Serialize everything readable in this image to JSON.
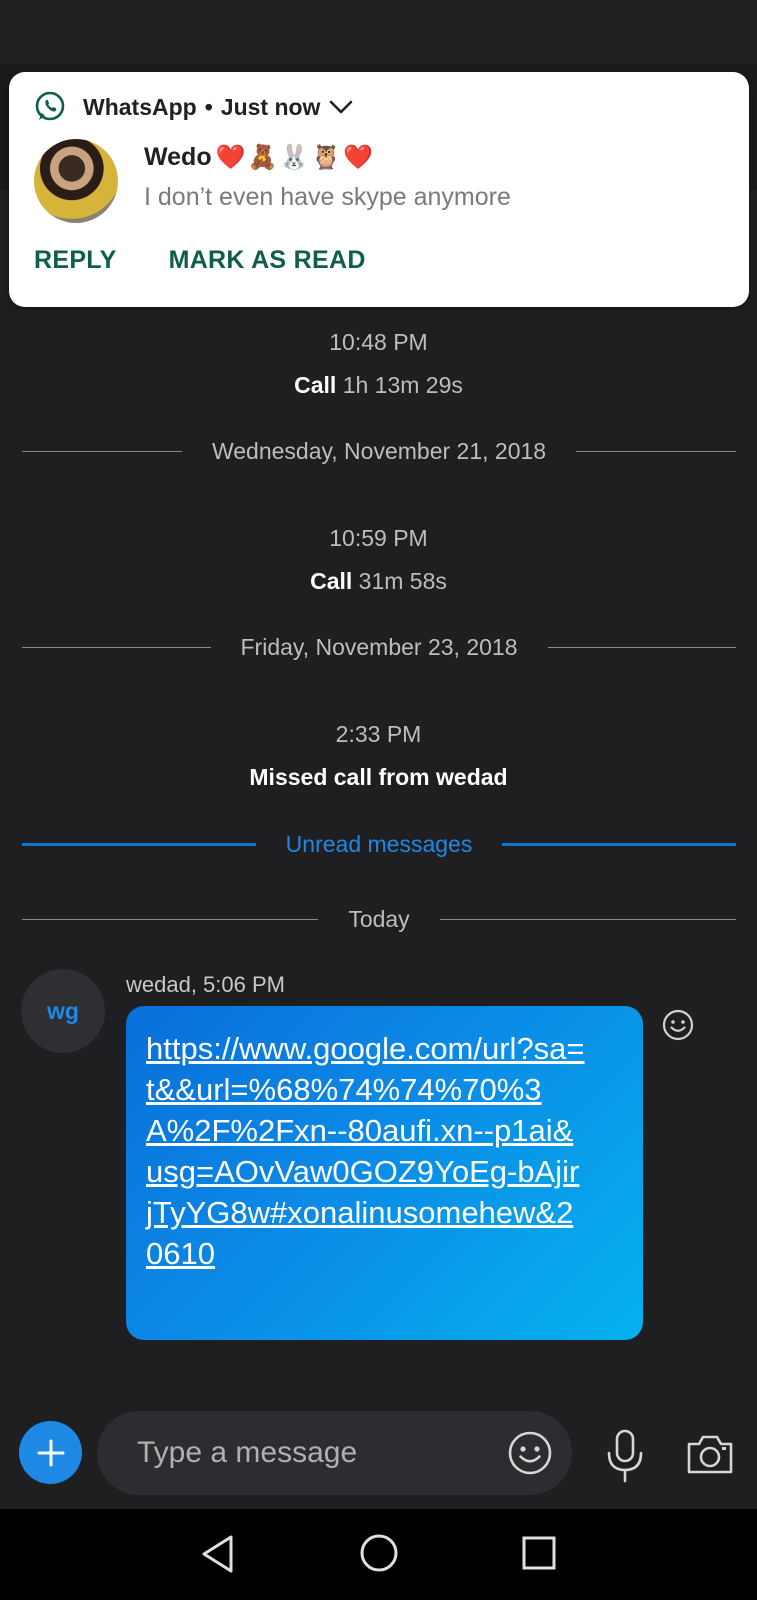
{
  "notification": {
    "app_name": "WhatsApp",
    "separator": "•",
    "time": "Just now",
    "sender_name": "Wedo",
    "sender_emoji": "❤️🧸🐰🦉❤️",
    "message": "I don’t even have skype anymore",
    "actions": {
      "reply": "REPLY",
      "mark_read": "MARK AS READ"
    }
  },
  "conversation": {
    "events": [
      {
        "time": "10:48 PM",
        "call_label": "Call",
        "call_duration": "1h 13m 29s"
      },
      {
        "date_divider": "Wednesday, November 21, 2018"
      },
      {
        "time": "10:59 PM",
        "call_label": "Call",
        "call_duration": "31m 58s"
      },
      {
        "date_divider": "Friday, November 23, 2018"
      },
      {
        "time": "2:33 PM",
        "missed": "Missed call from wedad"
      }
    ],
    "unread_divider": "Unread messages",
    "today_divider": "Today",
    "message": {
      "avatar_initials": "wg",
      "meta": "wedad, 5:06 PM",
      "link_text": "https://www.google.com/url?sa=t&&url=%68%74%74%70%3A%2F%2Fxn--80aufi.xn--p1ai&usg=AOvVaw0GOZ9YoEg-bAjirjTyYG8w#xonalinusomehew&20610"
    }
  },
  "composer": {
    "placeholder": "Type a message"
  },
  "colors": {
    "accent": "#1e88e5",
    "background": "#1f1f21",
    "whatsapp_green": "#0f5e4a"
  },
  "icons": {
    "app": "whatsapp-icon",
    "expand": "chevron-down-icon",
    "add": "plus-icon",
    "emoji": "smiley-icon",
    "mic": "microphone-icon",
    "camera": "camera-icon",
    "react": "smiley-icon",
    "nav_back": "back-triangle-icon",
    "nav_home": "home-circle-icon",
    "nav_recent": "recents-square-icon"
  }
}
